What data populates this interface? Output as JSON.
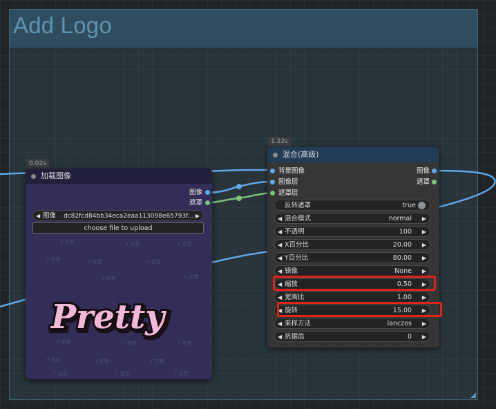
{
  "group": {
    "title": "Add Logo"
  },
  "load_node": {
    "time": "0.02s",
    "title": "加载图像",
    "outputs": [
      "图像",
      "遮罩"
    ],
    "image_widget": {
      "label": "图像",
      "value": "dc82fcd84bb34eca2eaa113098e65793f..."
    },
    "upload_label": "choose file to upload",
    "preview_text": "Pretty",
    "watermark": "Y 花卷"
  },
  "blend_node": {
    "time": "1.22s",
    "title": "混合(高级)",
    "inputs": [
      "背景图像",
      "图像层",
      "遮罩层"
    ],
    "outputs": [
      "图像",
      "遮罩"
    ],
    "toggle": {
      "label": "反转遮罩",
      "value": "true"
    },
    "widgets": [
      {
        "label": "混合模式",
        "value": "normal"
      },
      {
        "label": "不透明",
        "value": "100"
      },
      {
        "label": "X百分比",
        "value": "20.00"
      },
      {
        "label": "Y百分比",
        "value": "80.00"
      },
      {
        "label": "镜像",
        "value": "None"
      },
      {
        "label": "缩放",
        "value": "0.50"
      },
      {
        "label": "宽高比",
        "value": "1.00"
      },
      {
        "label": "旋转",
        "value": "15.00"
      },
      {
        "label": "采样方法",
        "value": "lanczos"
      },
      {
        "label": "抗锯齿",
        "value": "0"
      }
    ]
  },
  "colors": {
    "image_wire": "#5fa8e8",
    "mask_wire": "#7cc47a",
    "highlight": "#e02418"
  }
}
